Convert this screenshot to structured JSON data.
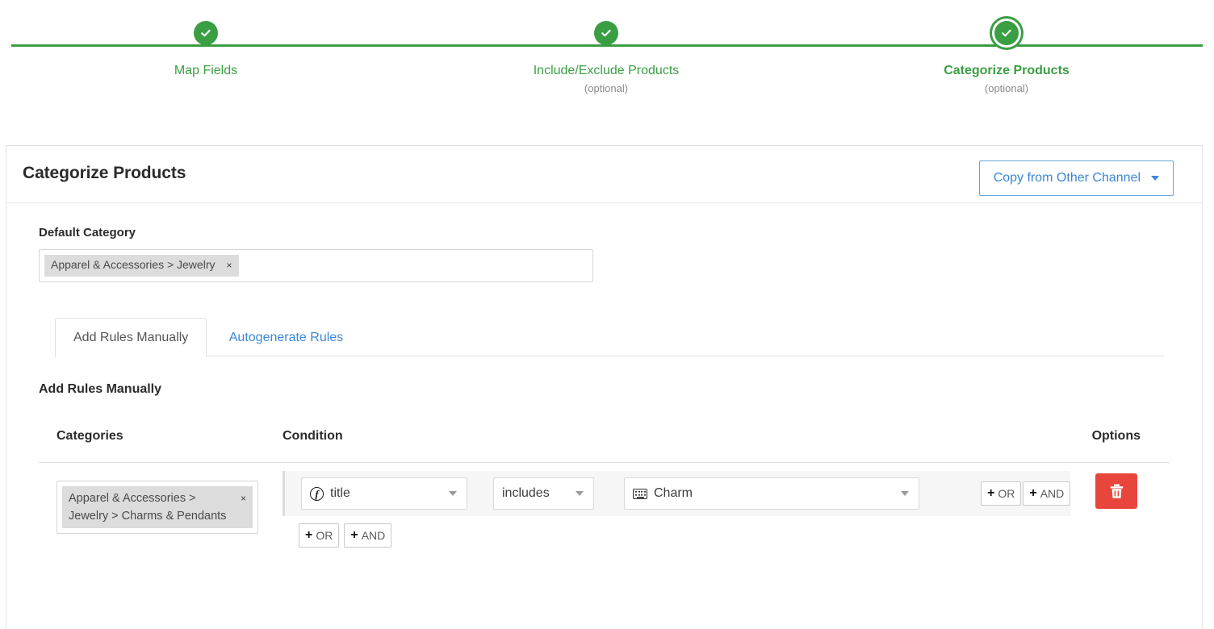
{
  "stepper": {
    "steps": [
      {
        "label": "Map Fields",
        "optional": "",
        "state": "complete",
        "icon": "check-circle-icon"
      },
      {
        "label": "Include/Exclude Products",
        "optional": "(optional)",
        "state": "complete",
        "icon": "check-circle-icon"
      },
      {
        "label": "Categorize Products",
        "optional": "(optional)",
        "state": "active",
        "icon": "check-circle-icon"
      }
    ],
    "accent_color": "#3a9e43",
    "optional_color": "#8a8a8a"
  },
  "card": {
    "title": "Categorize Products",
    "copy_button": {
      "label": "Copy from Other Channel",
      "icon": "chevron-down-icon",
      "color": "#3a87d8"
    }
  },
  "default_category": {
    "label": "Default Category",
    "token": "Apparel & Accessories > Jewelry",
    "remove_icon": "×",
    "placeholder": ""
  },
  "tabs": [
    {
      "label": "Add Rules Manually",
      "active": true
    },
    {
      "label": "Autogenerate Rules",
      "active": false
    }
  ],
  "rules_section": {
    "title": "Add Rules Manually",
    "columns": {
      "categories": "Categories",
      "condition": "Condition",
      "options": "Options"
    },
    "rows": [
      {
        "category_token": "Apparel & Accessories > Jewelry > Charms & Pendants",
        "remove_icon": "×",
        "condition": {
          "field": {
            "value": "title",
            "icon": "function-icon"
          },
          "operator": {
            "value": "includes"
          },
          "value": {
            "value": "Charm",
            "icon": "keyboard-icon"
          }
        },
        "inline_logic": [
          {
            "label": "OR",
            "plus": "+"
          },
          {
            "label": "AND",
            "plus": "+"
          }
        ],
        "below_logic": [
          {
            "label": "OR",
            "plus": "+"
          },
          {
            "label": "AND",
            "plus": "+"
          }
        ],
        "delete": {
          "icon": "trash-icon",
          "color": "#e8453c"
        }
      }
    ]
  }
}
